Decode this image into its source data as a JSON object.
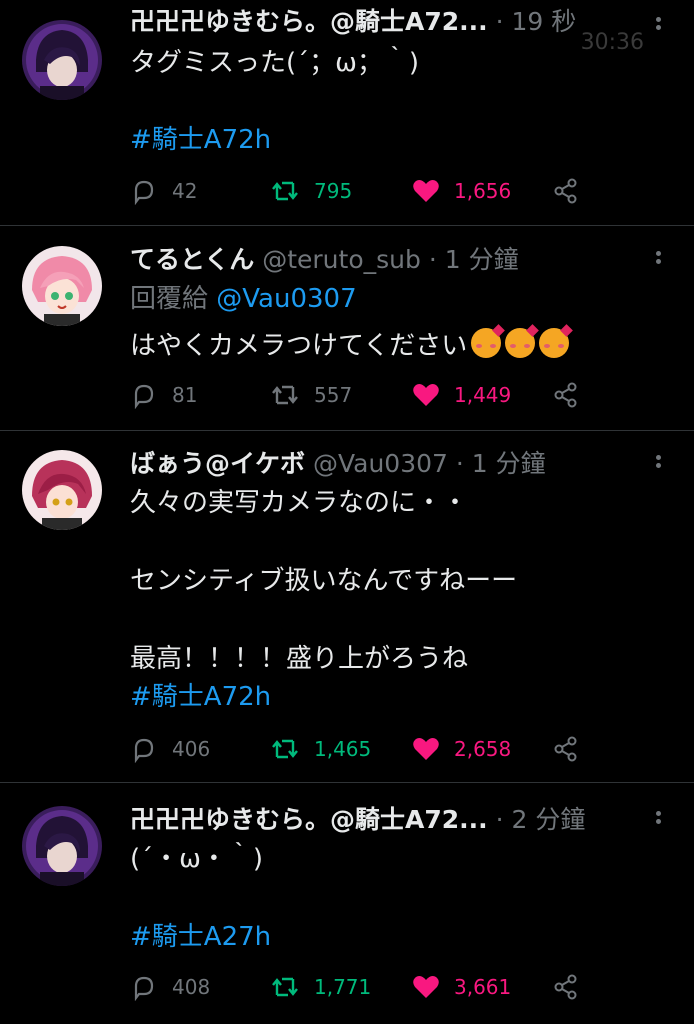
{
  "overlay_time": "30:36",
  "tweets": [
    {
      "display_name": "卍卍卍ゆきむら。@騎士A72...",
      "handle": "",
      "sep": "·",
      "time": "19 秒",
      "reply_to_label": "",
      "reply_to": "",
      "lines": [
        "タグミスった(´；ω；｀)",
        "",
        "#騎士A72h"
      ],
      "counts": {
        "reply": "42",
        "retweet": "795",
        "like": "1,656"
      },
      "retweeted": true
    },
    {
      "display_name": "てるとくん",
      "handle": "@teruto_sub",
      "sep": "·",
      "time": "1 分鐘",
      "reply_to_label": "回覆給",
      "reply_to": "@Vau0307",
      "lines": [
        "はやくカメラつけてください"
      ],
      "counts": {
        "reply": "81",
        "retweet": "557",
        "like": "1,449"
      },
      "retweeted": false
    },
    {
      "display_name": "ばぁう@イケボ",
      "handle": "@Vau0307",
      "sep": "·",
      "time": "1 分鐘",
      "reply_to_label": "",
      "reply_to": "",
      "lines": [
        "久々の実写カメラなのに・・",
        "",
        "センシティブ扱いなんですねーー",
        "",
        "最高！！！！盛り上がろうね",
        "#騎士A72h"
      ],
      "counts": {
        "reply": "406",
        "retweet": "1,465",
        "like": "2,658"
      },
      "retweeted": true
    },
    {
      "display_name": "卍卍卍ゆきむら。@騎士A72...",
      "handle": "",
      "sep": "·",
      "time": "2 分鐘",
      "reply_to_label": "",
      "reply_to": "",
      "lines": [
        "(´・ω・｀)",
        "",
        "#騎士A27h"
      ],
      "counts": {
        "reply": "408",
        "retweet": "1,771",
        "like": "3,661"
      },
      "retweeted": true
    }
  ],
  "colors": {
    "background": "#000000",
    "text": "#e7e9ea",
    "muted": "#71767b",
    "link": "#1d9bf0",
    "retweet": "#00ba7c",
    "like": "#f91880"
  }
}
